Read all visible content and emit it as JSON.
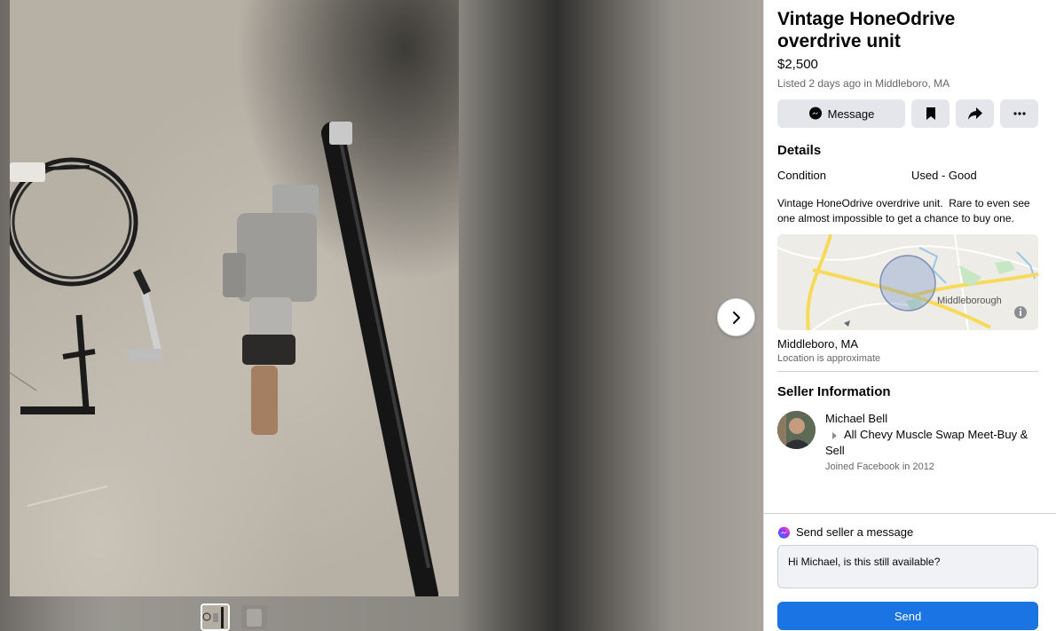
{
  "listing": {
    "title": "Vintage HoneOdrive overdrive unit",
    "price": "$2,500",
    "listed_text": "Listed 2 days ago in Middleboro, MA",
    "actions": {
      "message_label": "Message",
      "save_icon": "bookmark-icon",
      "share_icon": "share-icon",
      "more_icon": "more-icon"
    }
  },
  "details": {
    "heading": "Details",
    "condition_label": "Condition",
    "condition_value": "Used - Good",
    "description": "Vintage HoneOdrive overdrive unit.  Rare to even see one almost impossible to get a chance to buy one."
  },
  "map": {
    "town_label": "Middleborough",
    "location_name": "Middleboro, MA",
    "location_note": "Location is approximate",
    "info_icon": "info-icon"
  },
  "seller": {
    "heading": "Seller Information",
    "name": "Michael Bell",
    "group": "All Chevy Muscle Swap Meet-Buy & Sell",
    "joined": "Joined Facebook in 2012"
  },
  "composer": {
    "heading": "Send seller a message",
    "message_value": "Hi Michael, is this still available?",
    "send_label": "Send",
    "icon": "messenger-icon"
  },
  "media": {
    "next_icon": "chevron-right-icon",
    "thumbnails": 2
  },
  "colors": {
    "accent": "#1b74e4",
    "button_bg": "#e4e6eb",
    "secondary_text": "#65676b"
  }
}
